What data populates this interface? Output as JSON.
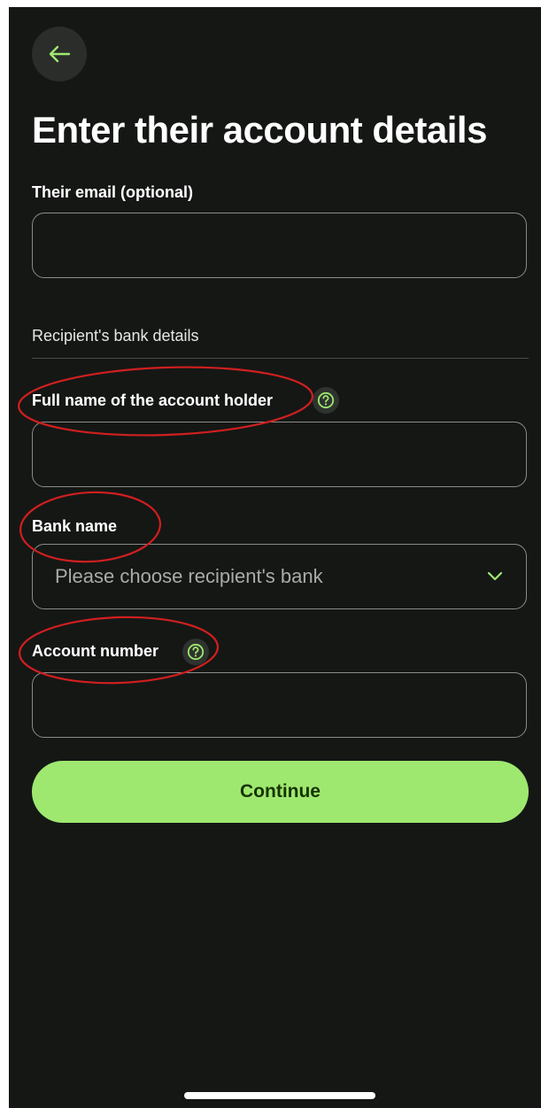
{
  "header": {
    "title": "Enter their account details"
  },
  "email": {
    "label": "Their email (optional)",
    "value": ""
  },
  "bank_details": {
    "section_label": "Recipient's bank details"
  },
  "full_name": {
    "label": "Full name of the account holder",
    "value": ""
  },
  "bank_name": {
    "label": "Bank name",
    "placeholder": "Please choose recipient's bank"
  },
  "account_number": {
    "label": "Account number",
    "value": ""
  },
  "actions": {
    "continue_label": "Continue"
  },
  "icons": {
    "back": "arrow-left-icon",
    "help": "question-circle-icon",
    "dropdown": "chevron-down-icon"
  },
  "colors": {
    "background": "#151715",
    "accent": "#9fe870",
    "button_text": "#163300",
    "annotation": "#d11f1f"
  }
}
